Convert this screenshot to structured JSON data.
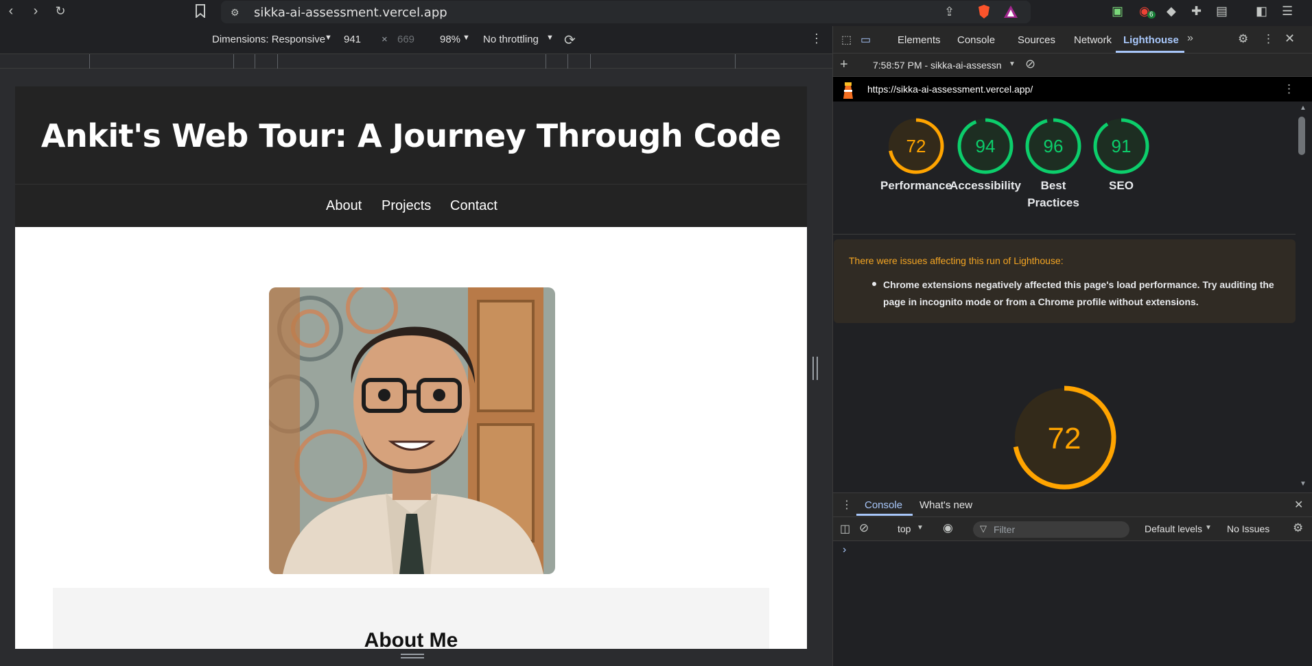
{
  "browser": {
    "url": "sikka-ai-assessment.vercel.app",
    "badge_count": "6"
  },
  "device_toolbar": {
    "dimensions_label": "Dimensions: Responsive",
    "width": "941",
    "times": "×",
    "height": "669",
    "zoom": "98%",
    "throttling": "No throttling"
  },
  "site": {
    "title": "Ankit's Web Tour: A Journey Through Code",
    "nav": [
      "About",
      "Projects",
      "Contact"
    ],
    "about_heading": "About Me"
  },
  "devtools": {
    "tabs": [
      "Elements",
      "Console",
      "Sources",
      "Network",
      "Lighthouse"
    ],
    "active_tab": "Lighthouse",
    "report_label": "7:58:57 PM - sikka-ai-assessn",
    "report_url": "https://sikka-ai-assessment.vercel.app/",
    "scores": [
      {
        "label": "Performance",
        "value": 72,
        "color": "#ffa400"
      },
      {
        "label": "Accessibility",
        "value": 94,
        "color": "#0cce6b"
      },
      {
        "label": "Best Practices",
        "value": 96,
        "color": "#0cce6b"
      },
      {
        "label": "SEO",
        "value": 91,
        "color": "#0cce6b"
      }
    ],
    "warning_title": "There were issues affecting this run of Lighthouse:",
    "warning_item": "Chrome extensions negatively affected this page's load performance. Try auditing the page in incognito mode or from a Chrome profile without extensions.",
    "big_score": 72,
    "drawer_tabs": [
      "Console",
      "What's new"
    ],
    "context": "top",
    "filter_placeholder": "Filter",
    "levels": "Default levels",
    "issues": "No Issues",
    "prompt": "›"
  }
}
